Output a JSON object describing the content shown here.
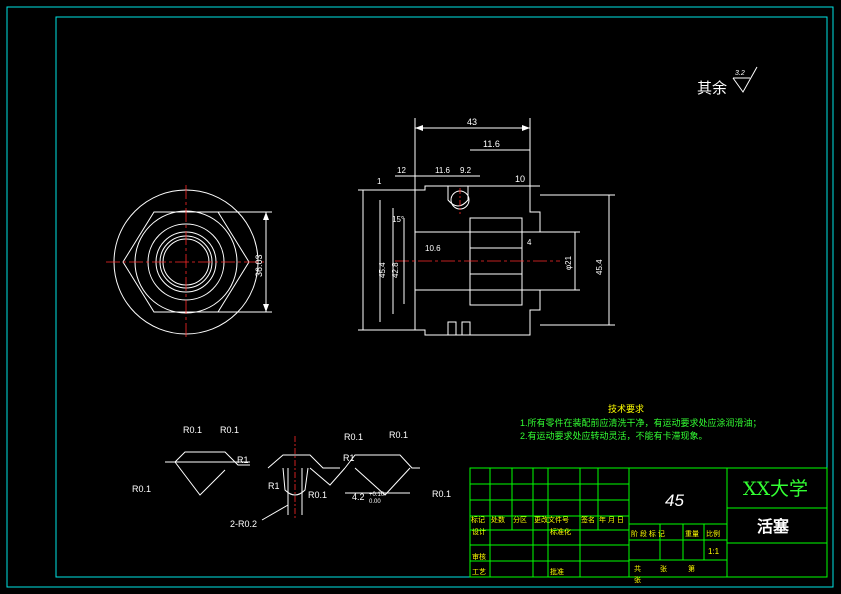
{
  "colors": {
    "background": "#000000",
    "frame": "#00e5e5",
    "geometry": "#ffffff",
    "centerline": "#ff2a2a",
    "notes": "#33ff33",
    "title_block": "#00ff00"
  },
  "surface_note": {
    "label": "其余",
    "roughness": "3.2"
  },
  "dimensions": {
    "overall_length": "43",
    "length_11_6_top": "11.6",
    "length_12": "12",
    "length_11_6": "11.6",
    "length_9_2": "9.2",
    "length_10": "10",
    "length_1": "1",
    "length_4": "4",
    "bore_21": "φ21",
    "hex_across": "36.03",
    "chamfer_15": "15°",
    "small_hole": "10.6",
    "dia_left_a": "45.4",
    "dia_left_b": "42.8",
    "dia_right": "45.4"
  },
  "detail_labels": {
    "r01_a": "R0.1",
    "r01_b": "R0.1",
    "r01_c": "R0.1",
    "r01_d": "R0.1",
    "r01_e": "R0.1",
    "r01_f": "R0.1",
    "r01_g": "R0.1",
    "r1_a": "R1",
    "r1_b": "R1",
    "r1_c": "R1",
    "r02": "2-R0.2",
    "dim_42": "4.2",
    "tol_42_up": "+0.10",
    "tol_42_low": "0.00"
  },
  "tech_requirements": {
    "title": "技术要求",
    "items": [
      "1.所有零件在装配前应清洗干净，有运动要求处应涂润滑油；",
      "2.有运动要求处应转动灵活，不能有卡滞现象。"
    ]
  },
  "title_block": {
    "material": "45",
    "university": "XX大学",
    "part_name": "活塞",
    "revision_headers": [
      "标记",
      "处数",
      "分区",
      "更改文件号",
      "签名",
      "年 月 日"
    ],
    "role_labels": [
      "设计",
      "标准化",
      "审核",
      "工艺",
      "批准"
    ],
    "stage_labels": [
      "阶 段 标 记",
      "重量",
      "比例"
    ],
    "scale": "1:1",
    "sheet_labels": [
      "共",
      "张",
      "第",
      "张"
    ]
  }
}
